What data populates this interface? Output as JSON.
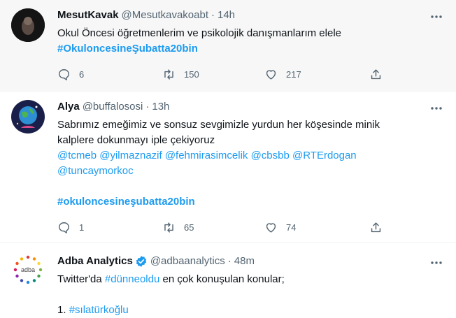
{
  "tweets": [
    {
      "name": "MesutKavak",
      "handle": "@Mesutkavakoabt",
      "time": "14h",
      "text_line1": "Okul Öncesi öğretmenlerim ve psikolojik danışmanlarım elele",
      "hashtag": "#OkuloncesineŞubatta20bin",
      "replies": "6",
      "retweets": "150",
      "likes": "217"
    },
    {
      "name": "Alya",
      "handle": "@buffalososi",
      "time": "13h",
      "text_line1": "Sabrımız emeğimiz ve sonsuz sevgimizle yurdun her köşesinde minik",
      "text_line2": "kalplere dokunmayı iple çekiyoruz",
      "mentions_line1": "@tcmeb @yilmaznazif @fehmirasimcelik @cbsbb @RTErdogan",
      "mentions_line2": "@tuncaymorkoc",
      "hashtag": "#okuloncesineşubatta20bin",
      "replies": "1",
      "retweets": "65",
      "likes": "74"
    },
    {
      "name": "Adba Analytics",
      "handle": "@adbaanalytics",
      "time": "48m",
      "text_prefix": "Twitter'da",
      "text_hashtag": "#dünneoldu",
      "text_suffix": "en çok konuşulan konular;",
      "list_number": "1.",
      "list_hashtag": "#sılatürkoğlu"
    }
  ],
  "separator": "·",
  "colors": {
    "link": "#1d9bf0",
    "muted": "#536471",
    "verified": "#1d9bf0"
  }
}
